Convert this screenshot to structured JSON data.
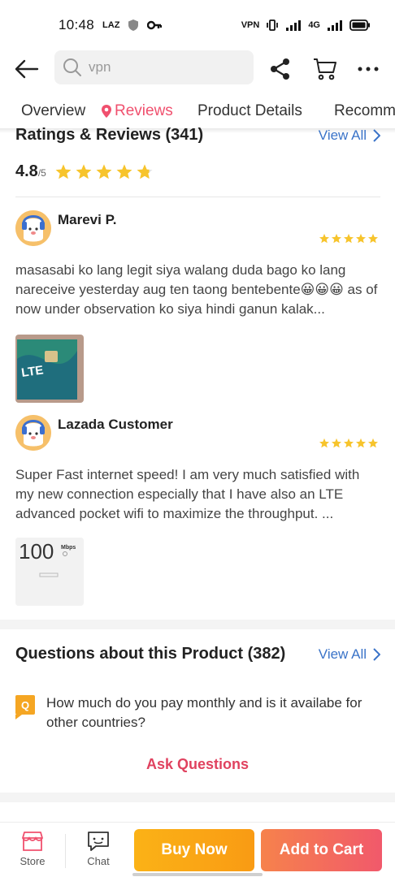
{
  "status_bar": {
    "time": "10:48",
    "app_badge": "LAZ",
    "vpn_label": "VPN",
    "network": "4G"
  },
  "search": {
    "value": "vpn",
    "placeholder": "vpn"
  },
  "tabs": [
    {
      "label": "Overview"
    },
    {
      "label": "Reviews",
      "active": true
    },
    {
      "label": "Product Details"
    },
    {
      "label": "Recomm"
    }
  ],
  "ratings": {
    "title": "Ratings & Reviews (341)",
    "view_all": "View All",
    "score": "4.8",
    "out_of": "/5",
    "stars": 4.8
  },
  "reviews": [
    {
      "name": "Marevi P.",
      "stars": 5,
      "text": "masasabi ko lang legit siya walang duda bago ko lang nareceive yesterday aug ten taong bentebente😀😀😀 as of now under observation ko siya hindi ganun kalak...",
      "image_caption": "LTE"
    },
    {
      "name": "Lazada Customer",
      "stars": 5,
      "text": "Super Fast internet speed! I am very much satisfied with my new connection especially that I have also an LTE advanced pocket wifi to maximize the throughput. ...",
      "image_caption": "100",
      "image_unit": "Mbps"
    }
  ],
  "questions": {
    "title": "Questions about this Product (382)",
    "view_all": "View All",
    "badge": "Q",
    "items": [
      {
        "text": "How much do you pay monthly and is it availabe for other countries?"
      }
    ],
    "ask_label": "Ask Questions"
  },
  "bottom_bar": {
    "store_label": "Store",
    "chat_label": "Chat",
    "buy_now_label": "Buy Now",
    "add_to_cart_label": "Add to Cart"
  },
  "colors": {
    "accent_pink": "#f0506e",
    "link_blue": "#3a73c8",
    "star_yellow": "#f7c42c",
    "buy_now": "#fbb216",
    "add_to_cart": "#f1596b"
  },
  "icons": [
    "back-arrow-icon",
    "search-icon",
    "share-icon",
    "cart-icon",
    "more-icon",
    "location-pin-icon",
    "chevron-right-icon",
    "star-icon",
    "store-icon",
    "chat-icon"
  ]
}
